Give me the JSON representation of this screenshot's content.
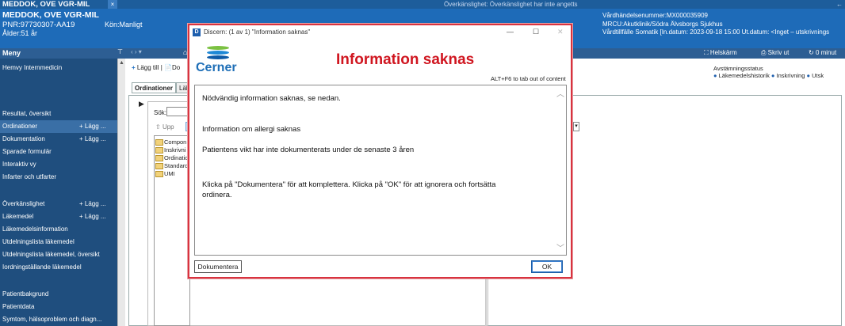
{
  "titlebar": {
    "patient_name": "MEDDOK, OVE VGR-MIL",
    "close": "×",
    "warning": "Överkänslighet: Överkänslighet har inte angetts",
    "back": "←"
  },
  "banner": {
    "patient_name": "MEDDOK, OVE VGR-MIL",
    "pnr": "PNR:97730307-AA19",
    "age": "Ålder:51 år",
    "sex": "Kön:Manligt",
    "encounter_no": "Vårdhändelsenummer:MX000035909",
    "unit": "MRCU:Akutklinik/Södra Älvsborgs Sjukhus",
    "stay": "Vårdtillfälle Somatik [In.datum: 2023-09-18 15:00 Ut.datum: <Inget – utskrivnings"
  },
  "toolstrip": {
    "menu_label": "Meny",
    "pin": "⊤",
    "nav": "‹  ›  ▾",
    "home": "⌂",
    "fullscreen": "Helskärm",
    "print": "Skriv ut",
    "refresh": "0 minut"
  },
  "sidebar": {
    "items": [
      {
        "label": "Hemvy Internmedicin",
        "add": ""
      },
      {
        "label": "Resultat, översikt",
        "add": ""
      },
      {
        "label": "Ordinationer",
        "add": "+ Lägg ..."
      },
      {
        "label": "Dokumentation",
        "add": "+ Lägg ..."
      },
      {
        "label": "Sparade formulär",
        "add": ""
      },
      {
        "label": "Interaktiv vy",
        "add": ""
      },
      {
        "label": "Infarter och utfarter",
        "add": ""
      },
      {
        "label": "Överkänslighet",
        "add": "+ Lägg ..."
      },
      {
        "label": "Läkemedel",
        "add": "+ Lägg ..."
      },
      {
        "label": "Läkemedelsinformation",
        "add": ""
      },
      {
        "label": "Utdelningslista läkemedel",
        "add": ""
      },
      {
        "label": "Utdelningslista läkemedel, översikt",
        "add": ""
      },
      {
        "label": "Iordningställande läkemedel",
        "add": ""
      },
      {
        "label": "Patientbakgrund",
        "add": ""
      },
      {
        "label": "Patientdata",
        "add": ""
      },
      {
        "label": "Symtom, hälsoproblem och diagn...",
        "add": ""
      }
    ]
  },
  "content": {
    "add_label": "Lägg till",
    "do_label": "Do",
    "tab_orders": "Ordinationer",
    "tab_2": "Läk",
    "search_label": "Sök:",
    "up_label": "Upp",
    "folders": [
      "Compon",
      "Inskrivni",
      "Ordinatio",
      "Standard",
      "UMI"
    ],
    "reconciliation_title": "Avstämningsstatus",
    "reconciliation_items": [
      "Läkemedelshistorik",
      "Inskrivning",
      "Utsk"
    ]
  },
  "dialog": {
    "title": "Discern: (1 av 1) \"Information saknas\"",
    "logo_word": "Cerner",
    "heading": "Information saknas",
    "hint": "ALT+F6 to tab out of content",
    "lines": [
      "Nödvändig information saknas, se nedan.",
      "Information om allergi saknas",
      "Patientens vikt har inte dokumenterats under de senaste 3 åren",
      "Klicka på \"Dokumentera\" för att komplettera. Klicka på \"OK\" för att ignorera och fortsätta",
      "ordinera."
    ],
    "document_button": "Dokumentera",
    "ok_button": "OK"
  }
}
